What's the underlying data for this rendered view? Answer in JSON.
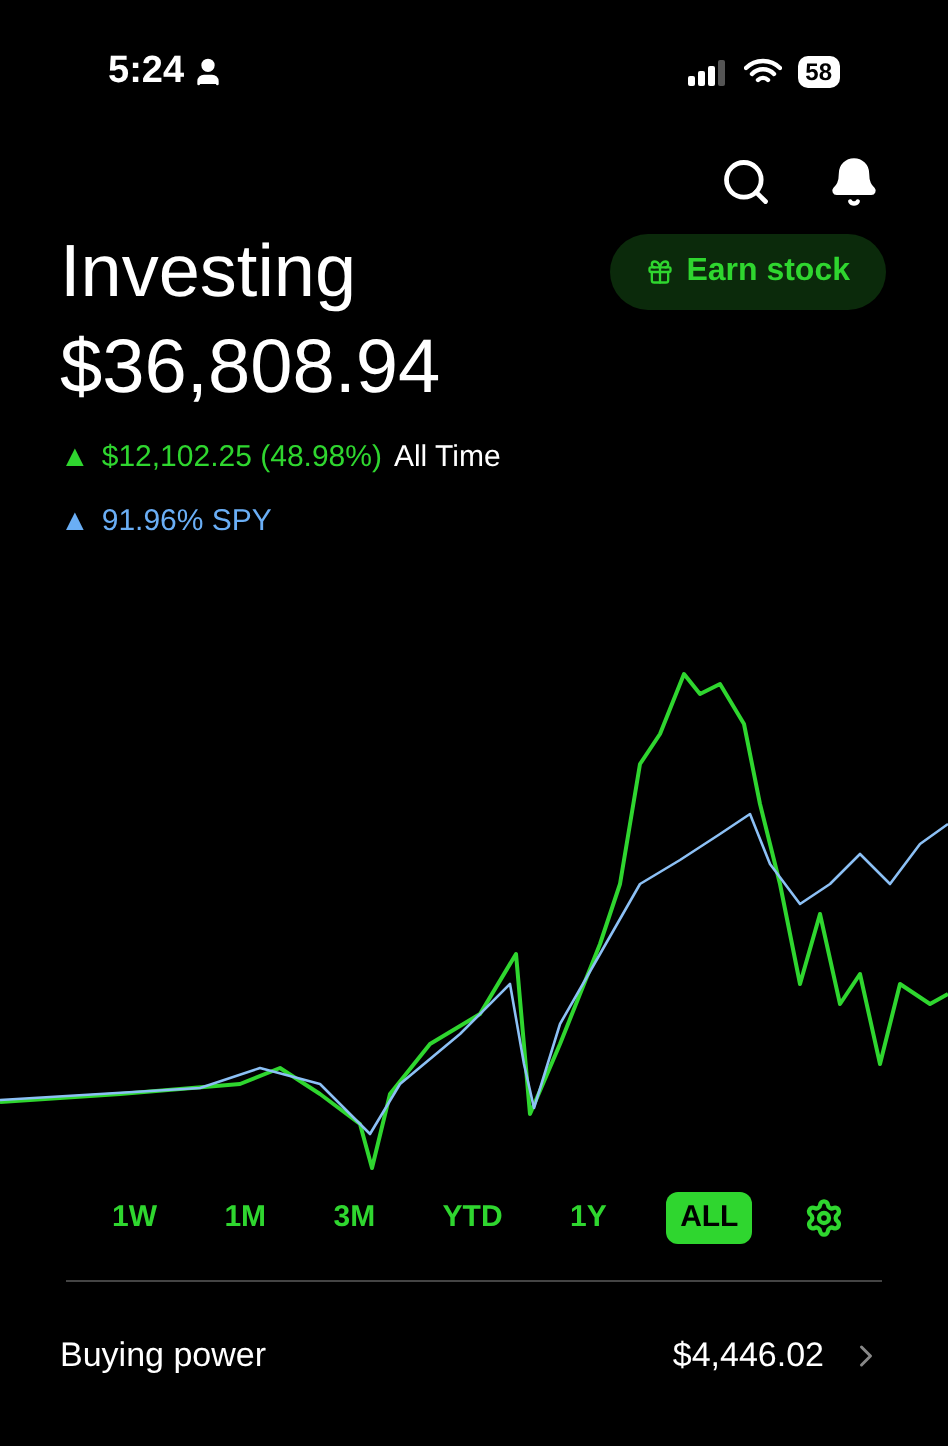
{
  "status_bar": {
    "time": "5:24",
    "battery": "58"
  },
  "header": {
    "title": "Investing",
    "balance": "$36,808.94",
    "earn_button": "Earn stock"
  },
  "performance": [
    {
      "kind": "gain",
      "arrow": "▲",
      "value": "$12,102.25 (48.98%)",
      "label": "All Time"
    },
    {
      "kind": "benchmark",
      "arrow": "▲",
      "value": "91.96% SPY"
    }
  ],
  "ranges": [
    {
      "label": "1W",
      "selected": false
    },
    {
      "label": "1M",
      "selected": false
    },
    {
      "label": "3M",
      "selected": false
    },
    {
      "label": "YTD",
      "selected": false
    },
    {
      "label": "1Y",
      "selected": false
    },
    {
      "label": "ALL",
      "selected": true
    }
  ],
  "buying_power": {
    "label": "Buying power",
    "value": "$4,446.02"
  }
}
